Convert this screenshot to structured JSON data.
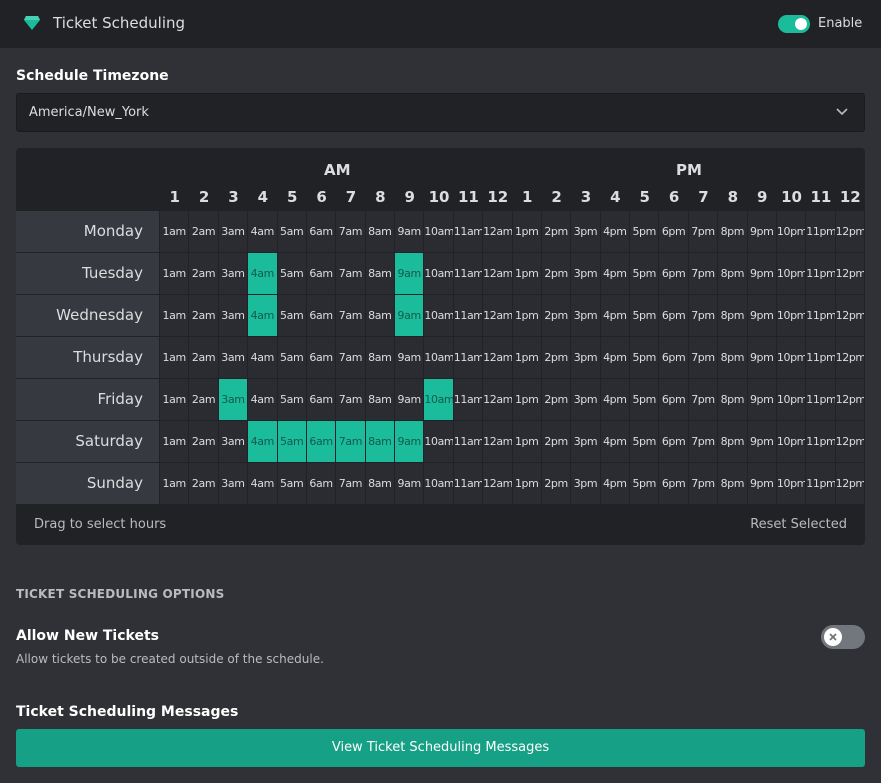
{
  "header": {
    "title": "Ticket Scheduling",
    "icon": "gem-icon",
    "toggle_label": "Enable",
    "toggle_on": true,
    "accent": "#1abc9c"
  },
  "timezone": {
    "label": "Schedule Timezone",
    "value": "America/New_York"
  },
  "schedule": {
    "am_label": "AM",
    "pm_label": "PM",
    "hour_numbers": [
      "1",
      "2",
      "3",
      "4",
      "5",
      "6",
      "7",
      "8",
      "9",
      "10",
      "11",
      "12",
      "1",
      "2",
      "3",
      "4",
      "5",
      "6",
      "7",
      "8",
      "9",
      "10",
      "11",
      "12"
    ],
    "hour_labels": [
      "1am",
      "2am",
      "3am",
      "4am",
      "5am",
      "6am",
      "7am",
      "8am",
      "9am",
      "10am",
      "11am",
      "12am",
      "1pm",
      "2pm",
      "3pm",
      "4pm",
      "5pm",
      "6pm",
      "7pm",
      "8pm",
      "9pm",
      "10pm",
      "11pm",
      "12pm"
    ],
    "days": [
      {
        "name": "Monday",
        "selected": []
      },
      {
        "name": "Tuesday",
        "selected": [
          "4am",
          "9am"
        ]
      },
      {
        "name": "Wednesday",
        "selected": [
          "4am",
          "9am"
        ]
      },
      {
        "name": "Thursday",
        "selected": []
      },
      {
        "name": "Friday",
        "selected": [
          "3am",
          "10am"
        ]
      },
      {
        "name": "Saturday",
        "selected": [
          "4am",
          "5am",
          "6am",
          "7am",
          "8am",
          "9am"
        ]
      },
      {
        "name": "Sunday",
        "selected": []
      }
    ],
    "hint": "Drag to select hours",
    "reset_label": "Reset Selected"
  },
  "options": {
    "heading": "TICKET SCHEDULING OPTIONS",
    "allow_title": "Allow New Tickets",
    "allow_desc": "Allow tickets to be created outside of the schedule.",
    "allow_on": false
  },
  "messages": {
    "title": "Ticket Scheduling Messages",
    "button_label": "View Ticket Scheduling Messages"
  }
}
